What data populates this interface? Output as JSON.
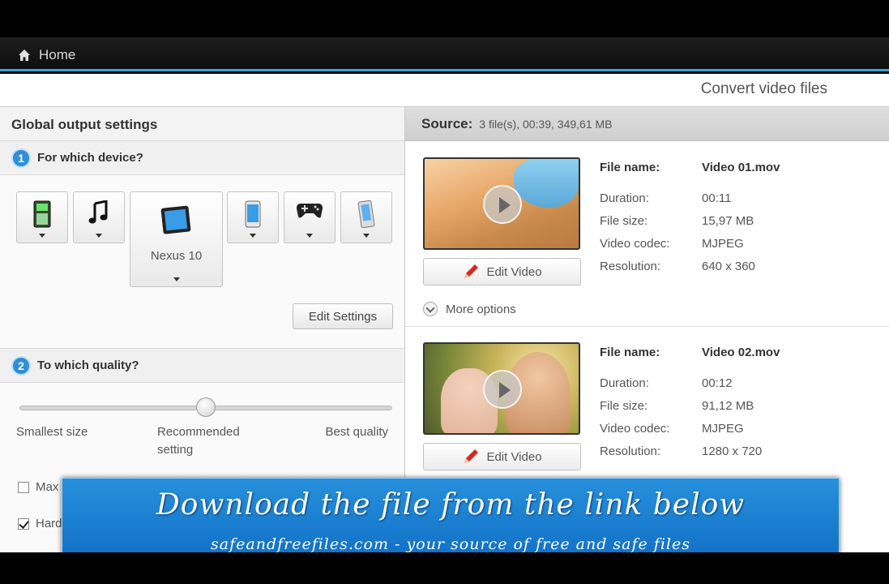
{
  "nav": {
    "home_label": "Home"
  },
  "header": {
    "convert_title": "Convert video files"
  },
  "left": {
    "title": "Global output settings",
    "step1": {
      "num": "1",
      "label": "For which device?"
    },
    "devices": [
      {
        "icon": "phone-keypad-icon"
      },
      {
        "icon": "music-note-icon"
      },
      {
        "icon": "tablet-icon",
        "label": "Nexus 10"
      },
      {
        "icon": "smartphone-icon"
      },
      {
        "icon": "gamepad-icon"
      },
      {
        "icon": "mobile-device-icon"
      }
    ],
    "edit_settings_label": "Edit Settings",
    "step2": {
      "num": "2",
      "label": "To which quality?"
    },
    "quality": {
      "level": 0.5,
      "smallest": "Smallest size",
      "recommended_1": "Recommended",
      "recommended_2": "setting",
      "best": "Best quality"
    },
    "options": [
      {
        "label": "Max",
        "checked": false
      },
      {
        "label": "Hard",
        "checked": true
      }
    ]
  },
  "right": {
    "source_label": "Source:",
    "source_info": "3 file(s), 00:39, 349,61 MB",
    "files": [
      {
        "file_name_key": "File name:",
        "file_name": "Video 01.mov",
        "duration_key": "Duration:",
        "duration": "00:11",
        "size_key": "File size:",
        "size": "15,97 MB",
        "codec_key": "Video codec:",
        "codec": "MJPEG",
        "res_key": "Resolution:",
        "resolution": "640 x 360",
        "edit_label": "Edit Video",
        "more_label": "More options"
      },
      {
        "file_name_key": "File name:",
        "file_name": "Video 02.mov",
        "duration_key": "Duration:",
        "duration": "00:12",
        "size_key": "File size:",
        "size": "91,12 MB",
        "codec_key": "Video codec:",
        "codec": "MJPEG",
        "res_key": "Resolution:",
        "resolution": "1280 x 720",
        "edit_label": "Edit Video"
      }
    ]
  },
  "banner": {
    "title": "Download the file from the link below",
    "subtitle": "safeandfreefiles.com - your source of free and safe files"
  },
  "colors": {
    "accent": "#3aa4e0",
    "step_blue": "#2f8fd8",
    "banner_blue": "#1a7fd0"
  }
}
